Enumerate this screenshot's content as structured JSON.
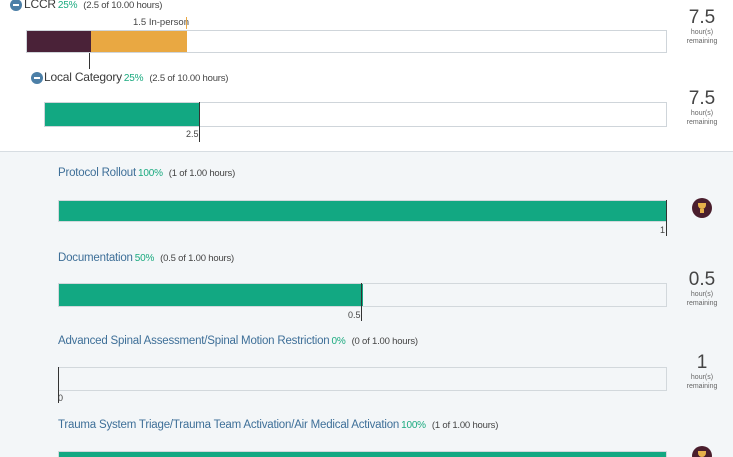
{
  "colors": {
    "green_fill": "#12a882",
    "purple_fill": "#4a2238",
    "orange_fill": "#e9a842",
    "title_blue": "#3e6f98",
    "percent_green": "#1aaa7f",
    "trophy_bg": "#4a1e2d"
  },
  "lccr": {
    "title": "LCCR",
    "percent": "25%",
    "detail": "(2.5 of 10.00 hours)",
    "progress": 0.25,
    "segments": [
      {
        "name": "completed",
        "value_hours": 1.0,
        "color": "#4a2238"
      },
      {
        "name": "in-person",
        "value_hours": 1.5,
        "color": "#e9a842"
      }
    ],
    "marker_label": "1.5 In-person",
    "remaining": {
      "value": "7.5",
      "unit_line1": "hour(s)",
      "unit_line2": "remaining"
    }
  },
  "local_category": {
    "title": "Local Category",
    "percent": "25%",
    "detail": "(2.5 of 10.00 hours)",
    "progress": 0.25,
    "value_label": "2.5",
    "remaining": {
      "value": "7.5",
      "unit_line1": "hour(s)",
      "unit_line2": "remaining"
    }
  },
  "protocols": [
    {
      "title": "Protocol Rollout",
      "percent": "100%",
      "detail": "(1 of 1.00 hours)",
      "progress": 1.0,
      "value_label": "1",
      "status_icon": "trophy-icon"
    },
    {
      "title": "Documentation",
      "percent": "50%",
      "detail": "(0.5 of 1.00 hours)",
      "progress": 0.5,
      "value_label": "0.5",
      "remaining": {
        "value": "0.5",
        "unit_line1": "hour(s)",
        "unit_line2": "remaining"
      }
    },
    {
      "title": "Advanced Spinal Assessment/Spinal Motion Restriction",
      "percent": "0%",
      "detail": "(0 of 1.00 hours)",
      "progress": 0.0,
      "value_label": "0",
      "remaining": {
        "value": "1",
        "unit_line1": "hour(s)",
        "unit_line2": "remaining"
      }
    },
    {
      "title": "Trauma System Triage/Trauma Team Activation/Air Medical Activation",
      "percent": "100%",
      "detail": "(1 of 1.00 hours)",
      "progress": 1.0,
      "status_icon": "trophy-icon"
    }
  ]
}
